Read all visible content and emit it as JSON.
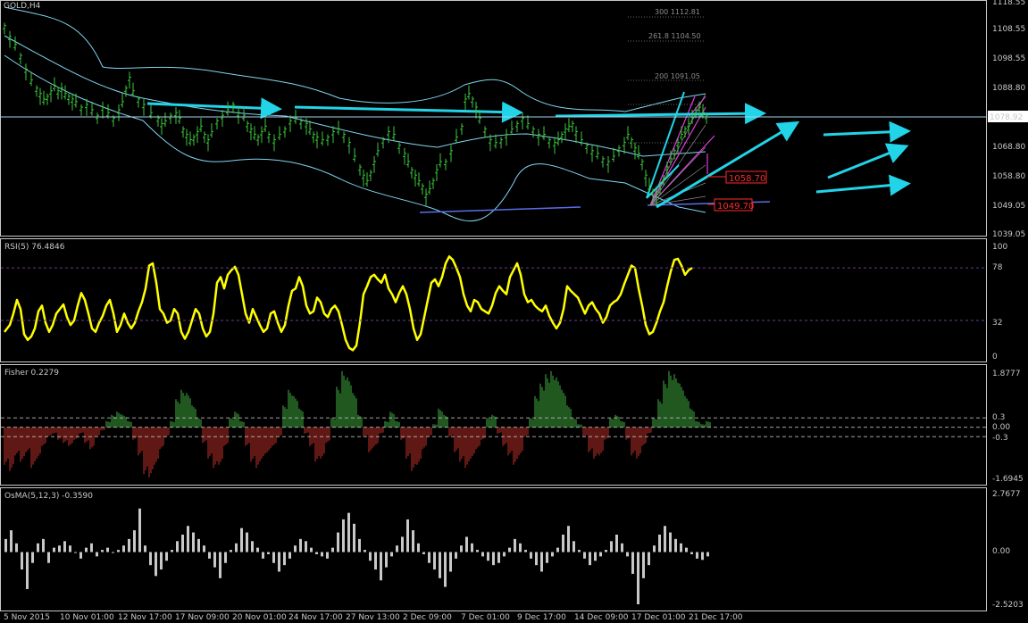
{
  "colors": {
    "background": "#000000",
    "border": "#c8c8c8",
    "candles": "#3cc83c",
    "bands": "#7fd6f2",
    "arrows": "#22d4e8",
    "rsi": "#ffff00",
    "fisher_pos": "#40b040",
    "fisher_neg": "#c0302a",
    "osma": "#c8c8c8",
    "level_line": "#9fd3ec",
    "price_tag_bg": "#ffffff",
    "support_line": "#5a6ee6",
    "fibo_magenta": "#e23ce2"
  },
  "header": {
    "symbol": "GOLD,H4"
  },
  "price_axis": {
    "ticks": [
      "1118.55",
      "1108.55",
      "1098.55",
      "1088.80",
      "1068.80",
      "1058.80",
      "1049.05",
      "1039.05"
    ],
    "current_price": "1078.92"
  },
  "markers": [
    "1058.70",
    "1049.70"
  ],
  "fibo_levels": [
    {
      "text": "300 1112.81",
      "price": 1112.81
    },
    {
      "text": "261.8 1104.50",
      "price": 1104.5
    },
    {
      "text": "200 1091.05",
      "price": 1091.05
    }
  ],
  "rsi": {
    "label": "RSI(5) 76.4846",
    "levels": [
      "100",
      "78",
      "32",
      "0"
    ]
  },
  "fisher": {
    "label": "Fisher 0.2279",
    "levels": [
      "1.8777",
      "0.3",
      "0.00",
      "-0.3",
      "-1.6945"
    ]
  },
  "osma": {
    "label": "OsMA(5,12,3) -0.3590",
    "levels": [
      "2.7677",
      "0.00",
      "-2.5203"
    ]
  },
  "time_axis": [
    "5 Nov 2015",
    "10 Nov 01:00",
    "12 Nov 17:00",
    "17 Nov 09:00",
    "20 Nov 01:00",
    "24 Nov 17:00",
    "27 Nov 13:00",
    "2 Dec 09:00",
    "7 Dec 01:00",
    "9 Dec 17:00",
    "14 Dec 09:00",
    "17 Dec 01:00",
    "21 Dec 17:00"
  ],
  "chart_data": [
    {
      "type": "line",
      "name": "price",
      "ylim": [
        1036,
        1121
      ],
      "x": [
        0,
        6,
        12,
        18,
        24,
        30,
        36,
        40,
        44,
        48,
        52,
        56,
        60,
        64,
        68,
        72,
        76,
        80,
        86,
        92,
        98,
        104,
        110,
        116,
        122,
        128,
        132,
        136,
        140,
        144,
        150,
        156,
        164,
        172,
        176,
        180,
        186,
        192,
        196,
        200,
        204,
        208,
        212,
        216,
        220,
        224,
        228,
        232,
        238,
        244,
        250,
        256,
        262,
        268,
        272,
        276,
        280,
        284,
        288,
        292,
        296,
        302,
        308,
        314,
        320,
        326,
        332,
        338,
        342,
        346,
        350,
        356,
        362,
        368,
        374,
        380,
        386,
        392,
        398,
        402,
        406,
        410,
        414,
        418,
        424,
        430,
        436,
        442,
        448,
        452,
        456,
        460,
        464,
        468,
        472,
        476,
        480,
        484,
        488,
        494,
        500,
        506,
        512,
        516,
        520,
        524,
        528,
        532,
        538,
        544,
        550,
        556,
        562,
        568,
        574,
        580,
        586,
        592,
        598,
        604,
        610,
        616,
        620,
        624,
        628,
        632,
        636,
        640,
        646,
        652,
        658,
        664,
        670,
        676,
        682,
        688,
        694,
        698,
        702,
        706,
        710,
        714,
        718,
        722,
        726,
        730,
        734,
        738,
        742,
        746,
        750,
        754,
        758,
        762,
        766,
        770,
        774,
        778,
        782,
        786
      ],
      "y": [
        1112,
        1108,
        1105,
        1101,
        1096,
        1092,
        1089,
        1087,
        1085,
        1086,
        1088,
        1090,
        1088,
        1089,
        1087,
        1086,
        1085,
        1084,
        1082,
        1083,
        1081,
        1079,
        1082,
        1080,
        1078,
        1081,
        1084,
        1089,
        1093,
        1088,
        1085,
        1083,
        1080,
        1078,
        1076,
        1077,
        1079,
        1080,
        1078,
        1074,
        1072,
        1070,
        1071,
        1073,
        1075,
        1072,
        1070,
        1073,
        1077,
        1079,
        1081,
        1083,
        1080,
        1079,
        1076,
        1074,
        1072,
        1071,
        1073,
        1075,
        1072,
        1070,
        1072,
        1074,
        1077,
        1078,
        1077,
        1076,
        1074,
        1072,
        1071,
        1070,
        1071,
        1073,
        1074,
        1072,
        1069,
        1064,
        1060,
        1057,
        1055,
        1058,
        1062,
        1066,
        1070,
        1073,
        1072,
        1068,
        1065,
        1062,
        1059,
        1057,
        1055,
        1053,
        1050,
        1052,
        1055,
        1059,
        1062,
        1062,
        1066,
        1071,
        1075,
        1085,
        1087,
        1085,
        1082,
        1078,
        1074,
        1070,
        1069,
        1070,
        1072,
        1074,
        1076,
        1078,
        1076,
        1074,
        1072,
        1072,
        1070,
        1069,
        1070,
        1072,
        1074,
        1075,
        1076,
        1073,
        1070,
        1068,
        1066,
        1065,
        1063,
        1062,
        1064,
        1067,
        1069,
        1072,
        1070,
        1067,
        1065,
        1062,
        1057,
        1053,
        1051,
        1050,
        1052,
        1056,
        1060,
        1063,
        1066,
        1069,
        1072,
        1074,
        1076,
        1078,
        1081,
        1082,
        1080,
        1079
      ]
    },
    {
      "type": "line",
      "name": "RSI(5)",
      "ylim": [
        0,
        100
      ],
      "x": [
        0,
        6,
        10,
        14,
        18,
        22,
        26,
        30,
        34,
        38,
        42,
        46,
        50,
        54,
        58,
        62,
        66,
        70,
        74,
        78,
        82,
        86,
        90,
        94,
        98,
        102,
        106,
        110,
        114,
        118,
        122,
        126,
        130,
        134,
        138,
        142,
        146,
        150,
        154,
        158,
        162,
        166,
        170,
        174,
        178,
        182,
        186,
        190,
        194,
        198,
        202,
        206,
        210,
        214,
        218,
        222,
        226,
        230,
        234,
        238,
        242,
        246,
        250,
        254,
        258,
        262,
        266,
        270,
        274,
        278,
        282,
        286,
        290,
        294,
        298,
        302,
        306,
        310,
        314,
        318,
        322,
        326,
        330,
        334,
        338,
        342,
        346,
        350,
        354,
        358,
        362,
        366,
        370,
        374,
        378,
        382,
        386,
        390,
        394,
        398,
        402,
        406,
        410,
        414,
        418,
        422,
        426,
        430,
        434,
        438,
        442,
        446,
        450,
        454,
        458,
        462,
        466,
        470,
        474,
        478,
        482,
        486,
        490,
        494,
        498,
        502,
        506,
        510,
        514,
        518,
        522,
        526,
        530,
        534,
        538,
        542,
        546,
        550,
        554,
        558,
        562,
        566,
        570,
        574,
        578,
        582,
        586,
        590,
        594,
        598,
        602,
        606,
        610,
        614,
        618,
        622,
        626,
        630,
        634,
        638,
        642,
        646,
        650,
        654,
        658,
        662,
        666,
        670,
        674,
        678,
        682,
        686,
        690,
        694,
        698,
        702,
        706,
        710,
        714,
        718,
        722,
        726,
        730,
        734,
        738,
        742,
        746,
        750,
        754,
        758,
        762,
        766,
        770,
        774,
        778,
        782,
        786,
        790
      ],
      "y": [
        22,
        28,
        38,
        50,
        42,
        20,
        15,
        18,
        25,
        40,
        45,
        30,
        22,
        28,
        38,
        42,
        46,
        35,
        28,
        32,
        45,
        56,
        50,
        38,
        25,
        22,
        30,
        36,
        45,
        50,
        38,
        22,
        28,
        38,
        30,
        25,
        30,
        40,
        48,
        60,
        80,
        82,
        65,
        42,
        38,
        30,
        32,
        42,
        38,
        22,
        16,
        22,
        32,
        42,
        38,
        25,
        18,
        22,
        38,
        65,
        70,
        60,
        72,
        76,
        79,
        72,
        55,
        38,
        30,
        42,
        35,
        28,
        22,
        25,
        38,
        40,
        30,
        22,
        28,
        45,
        58,
        60,
        70,
        62,
        45,
        38,
        40,
        52,
        48,
        38,
        35,
        42,
        45,
        40,
        28,
        15,
        8,
        6,
        10,
        30,
        55,
        62,
        70,
        72,
        68,
        65,
        72,
        60,
        55,
        48,
        56,
        62,
        55,
        42,
        25,
        15,
        20,
        35,
        50,
        65,
        68,
        62,
        70,
        82,
        88,
        85,
        78,
        70,
        55,
        45,
        40,
        50,
        48,
        42,
        40,
        38,
        45,
        56,
        62,
        58,
        55,
        70,
        76,
        82,
        72,
        55,
        48,
        50,
        45,
        42,
        40,
        45,
        36,
        30,
        25,
        30,
        42,
        62,
        58,
        55,
        52,
        45,
        38,
        45,
        48,
        42,
        38,
        30,
        35,
        45,
        48,
        50,
        55,
        64,
        72,
        80,
        78,
        60,
        45,
        28,
        20,
        22,
        30,
        40,
        48,
        62,
        75,
        85,
        86,
        80,
        72,
        76,
        78
      ]
    },
    {
      "type": "bar",
      "name": "Fisher",
      "ylim": [
        -1.6945,
        1.8777
      ],
      "x": [
        0,
        6,
        12,
        18,
        24,
        30,
        36,
        42,
        48,
        54,
        60,
        66,
        72,
        78,
        84,
        90,
        96,
        102,
        108,
        114,
        120,
        126,
        132,
        138,
        144,
        150,
        156,
        162,
        168,
        174,
        180,
        186,
        192,
        198,
        204,
        210,
        216,
        222,
        228,
        234,
        240,
        246,
        252,
        258,
        264,
        270,
        276,
        282,
        288,
        294,
        300,
        306,
        312,
        318,
        324,
        330,
        336,
        342,
        348,
        354,
        360,
        366,
        372,
        378,
        384,
        390,
        396,
        402,
        408,
        414,
        420,
        426,
        432,
        438,
        444,
        450,
        456,
        462,
        468,
        474,
        480,
        486,
        492,
        498,
        504,
        510,
        516,
        522,
        528,
        534,
        540,
        546,
        552,
        558,
        564,
        570,
        576,
        582,
        588,
        594,
        600,
        606,
        612,
        618,
        624,
        630,
        636,
        642,
        648,
        654,
        660,
        666,
        672,
        678,
        684,
        690,
        696,
        702,
        708,
        714,
        720,
        726,
        732,
        738,
        744,
        750,
        756,
        762,
        768,
        774,
        780,
        786
      ],
      "values": [
        -1.2,
        -1.4,
        -0.9,
        -1.1,
        -0.8,
        -1.3,
        -1.0,
        -0.6,
        -0.3,
        -0.2,
        -0.4,
        -0.5,
        -0.6,
        -0.4,
        -0.2,
        -0.5,
        -0.7,
        -0.3,
        -0.1,
        0.2,
        0.4,
        0.5,
        0.4,
        0.2,
        -0.4,
        -0.9,
        -1.5,
        -1.6,
        -1.2,
        -0.7,
        -0.3,
        0.2,
        0.9,
        1.2,
        1.1,
        0.7,
        0.3,
        -0.5,
        -1.0,
        -1.3,
        -1.2,
        -0.6,
        0.3,
        0.5,
        0.2,
        -0.6,
        -1.1,
        -1.3,
        -1.0,
        -0.8,
        -0.6,
        -0.3,
        0.7,
        1.2,
        1.0,
        0.6,
        -0.2,
        -0.6,
        -1.1,
        -1.0,
        -0.5,
        0.3,
        1.3,
        1.8,
        1.6,
        1.1,
        0.4,
        -0.3,
        -0.8,
        -0.6,
        -0.2,
        0.2,
        0.5,
        0.2,
        -0.4,
        -1.0,
        -1.4,
        -1.2,
        -0.7,
        -0.3,
        0.1,
        0.6,
        0.4,
        -0.3,
        -0.8,
        -1.1,
        -1.3,
        -1.0,
        -0.7,
        -0.4,
        0.3,
        0.4,
        -0.2,
        -0.6,
        -0.9,
        -1.2,
        -0.9,
        -0.3,
        0.3,
        1.0,
        1.4,
        1.7,
        1.8,
        1.6,
        1.2,
        0.7,
        0.3,
        0.1,
        -0.3,
        -0.8,
        -1.0,
        -0.9,
        -0.4,
        0.3,
        0.4,
        0.2,
        -0.4,
        -0.9,
        -1.0,
        -0.6,
        -0.2,
        0.3,
        0.9,
        1.5,
        1.8,
        1.7,
        1.4,
        1.0,
        0.6,
        0.2,
        0.1,
        0.2
      ]
    },
    {
      "type": "bar",
      "name": "OsMA(5,12,3)",
      "ylim": [
        -2.5203,
        2.7677
      ],
      "x": [
        0,
        6,
        12,
        18,
        24,
        30,
        36,
        42,
        48,
        54,
        60,
        66,
        72,
        78,
        84,
        90,
        96,
        102,
        108,
        114,
        120,
        126,
        132,
        138,
        144,
        150,
        156,
        162,
        168,
        174,
        180,
        186,
        192,
        198,
        204,
        210,
        216,
        222,
        228,
        234,
        240,
        246,
        252,
        258,
        264,
        270,
        276,
        282,
        288,
        294,
        300,
        306,
        312,
        318,
        324,
        330,
        336,
        342,
        348,
        354,
        360,
        366,
        372,
        378,
        384,
        390,
        396,
        402,
        408,
        414,
        420,
        426,
        432,
        438,
        444,
        450,
        456,
        462,
        468,
        474,
        480,
        486,
        492,
        498,
        504,
        510,
        516,
        522,
        528,
        534,
        540,
        546,
        552,
        558,
        564,
        570,
        576,
        582,
        588,
        594,
        600,
        606,
        612,
        618,
        624,
        630,
        636,
        642,
        648,
        654,
        660,
        666,
        672,
        678,
        684,
        690,
        696,
        702,
        708,
        714,
        720,
        726,
        732,
        738,
        744,
        750,
        756,
        762,
        768,
        774,
        780,
        786
      ],
      "values": [
        0.6,
        1.0,
        0.4,
        -0.8,
        -1.7,
        -0.5,
        0.4,
        0.6,
        -0.5,
        0.2,
        0.3,
        0.5,
        0.3,
        0.0,
        -0.3,
        0.2,
        0.4,
        -0.2,
        0.1,
        0.2,
        0.0,
        0.1,
        0.3,
        0.6,
        1.0,
        2.0,
        0.3,
        -0.6,
        -1.1,
        -0.8,
        -0.4,
        0.1,
        0.5,
        0.8,
        1.2,
        0.9,
        0.6,
        0.3,
        -0.3,
        -0.7,
        -1.2,
        -0.5,
        0.1,
        0.4,
        1.1,
        0.9,
        0.5,
        0.2,
        -0.3,
        -0.1,
        -0.5,
        -0.9,
        -0.6,
        -0.3,
        0.3,
        0.6,
        0.5,
        0.2,
        -0.1,
        -0.2,
        -0.3,
        0.2,
        0.9,
        1.5,
        1.8,
        1.3,
        0.6,
        0.1,
        -0.4,
        -0.8,
        -1.3,
        -0.7,
        -0.2,
        0.3,
        0.7,
        1.5,
        1.0,
        0.4,
        -0.1,
        -0.5,
        -0.8,
        -1.2,
        -1.6,
        -0.9,
        -0.3,
        0.3,
        0.7,
        0.4,
        0.1,
        -0.2,
        -0.4,
        -0.6,
        -0.5,
        -0.2,
        0.2,
        0.6,
        0.4,
        0.1,
        -0.3,
        -0.6,
        -0.9,
        -0.5,
        -0.2,
        0.2,
        0.8,
        1.2,
        0.5,
        0.1,
        -0.3,
        -0.6,
        -0.4,
        -0.2,
        0.1,
        0.5,
        0.8,
        0.4,
        -0.2,
        -1.0,
        -2.4,
        -1.2,
        -0.6,
        0.3,
        0.8,
        1.2,
        0.9,
        0.6,
        0.4,
        0.2,
        -0.1,
        -0.3,
        -0.36,
        -0.2
      ]
    }
  ]
}
